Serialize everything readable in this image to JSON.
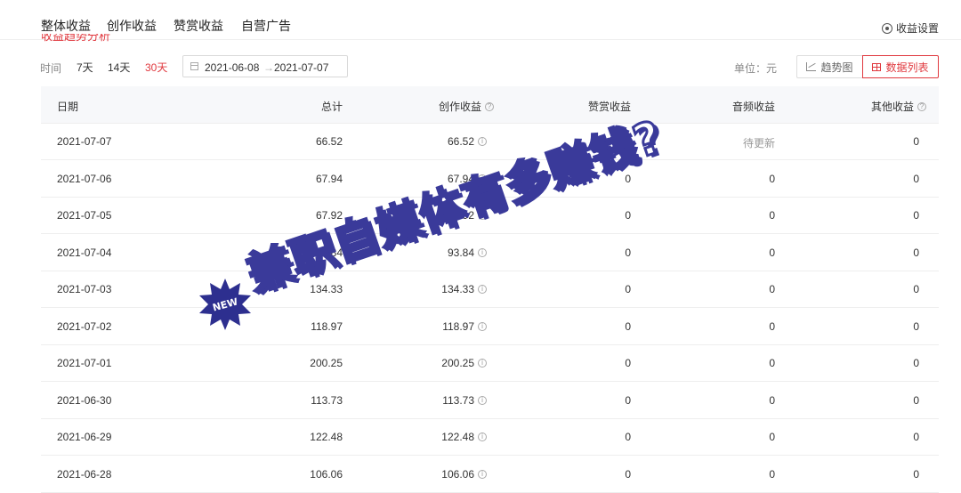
{
  "tabs": [
    "整体收益",
    "创作收益",
    "赞赏收益",
    "自营广告"
  ],
  "settings_label": "收益设置",
  "section_title": "收益趋势分析",
  "filters": {
    "time_label": "时间",
    "ranges": [
      "7天",
      "14天",
      "30天"
    ],
    "active_range": "30天",
    "date_start": "2021-06-08",
    "date_sep": "→",
    "date_end": "2021-07-07",
    "unit": "单位：元",
    "trend_button": "趋势图",
    "list_button": "数据列表"
  },
  "table": {
    "headers": [
      "日期",
      "总计",
      "创作收益",
      "赞赏收益",
      "音频收益",
      "其他收益"
    ],
    "rows": [
      {
        "date": "2021-07-07",
        "total": "66.52",
        "create": "66.52",
        "zan": "0",
        "audio": "待更新",
        "other": "0"
      },
      {
        "date": "2021-07-06",
        "total": "67.94",
        "create": "67.94",
        "zan": "0",
        "audio": "0",
        "other": "0"
      },
      {
        "date": "2021-07-05",
        "total": "67.92",
        "create": "67.92",
        "zan": "0",
        "audio": "0",
        "other": "0"
      },
      {
        "date": "2021-07-04",
        "total": "93.84",
        "create": "93.84",
        "zan": "0",
        "audio": "0",
        "other": "0"
      },
      {
        "date": "2021-07-03",
        "total": "134.33",
        "create": "134.33",
        "zan": "0",
        "audio": "0",
        "other": "0"
      },
      {
        "date": "2021-07-02",
        "total": "118.97",
        "create": "118.97",
        "zan": "0",
        "audio": "0",
        "other": "0"
      },
      {
        "date": "2021-07-01",
        "total": "200.25",
        "create": "200.25",
        "zan": "0",
        "audio": "0",
        "other": "0"
      },
      {
        "date": "2021-06-30",
        "total": "113.73",
        "create": "113.73",
        "zan": "0",
        "audio": "0",
        "other": "0"
      },
      {
        "date": "2021-06-29",
        "total": "122.48",
        "create": "122.48",
        "zan": "0",
        "audio": "0",
        "other": "0"
      },
      {
        "date": "2021-06-28",
        "total": "106.06",
        "create": "106.06",
        "zan": "0",
        "audio": "0",
        "other": "0"
      }
    ]
  },
  "overlay": {
    "watermark_text": "兼职自媒体有多赚钱?",
    "badge_text": "NEW"
  }
}
